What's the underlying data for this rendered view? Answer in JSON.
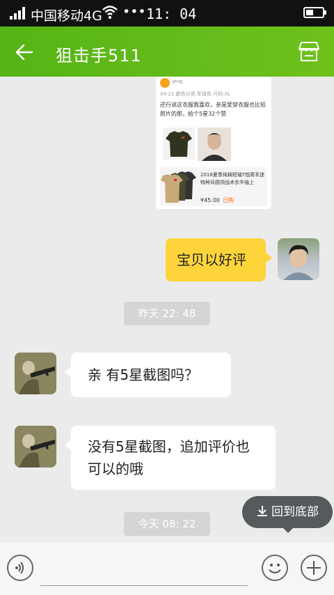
{
  "status_bar": {
    "carrier": "中国移动4G",
    "dots": "•••",
    "time": "11: 04"
  },
  "header": {
    "title": "狙击手511",
    "back_icon": "back-arrow-icon",
    "shop_icon": "store-icon",
    "color": "#5cb617"
  },
  "product_card": {
    "username": "t**0",
    "meta": "04-21 颜色分类:军绿色 尺码:XL",
    "review_text": "还行说这衣服我喜欢，亲是爱穿衣服也比较照片的那，给个5星32个赞",
    "product_desc": "2018夏季纯棉短袖T恤男军迷特种兵圆领战术衣半袖上",
    "price": "¥45.00",
    "price_tag": "已购"
  },
  "messages": [
    {
      "side": "me",
      "text": "宝贝以好评"
    },
    {
      "type": "time",
      "text": "昨天  22: 48"
    },
    {
      "side": "them",
      "text": "亲  有5星截图吗？"
    },
    {
      "side": "them",
      "text": "没有5星截图，追加评价也可以的哦"
    },
    {
      "type": "time",
      "text": "今天  08: 22"
    }
  ],
  "back_to_bottom": {
    "label": "回到底部",
    "icon": "download-arrow-icon"
  },
  "input_bar": {
    "voice_icon": "voice-icon",
    "emoji_icon": "emoji-icon",
    "plus_icon": "plus-icon"
  }
}
